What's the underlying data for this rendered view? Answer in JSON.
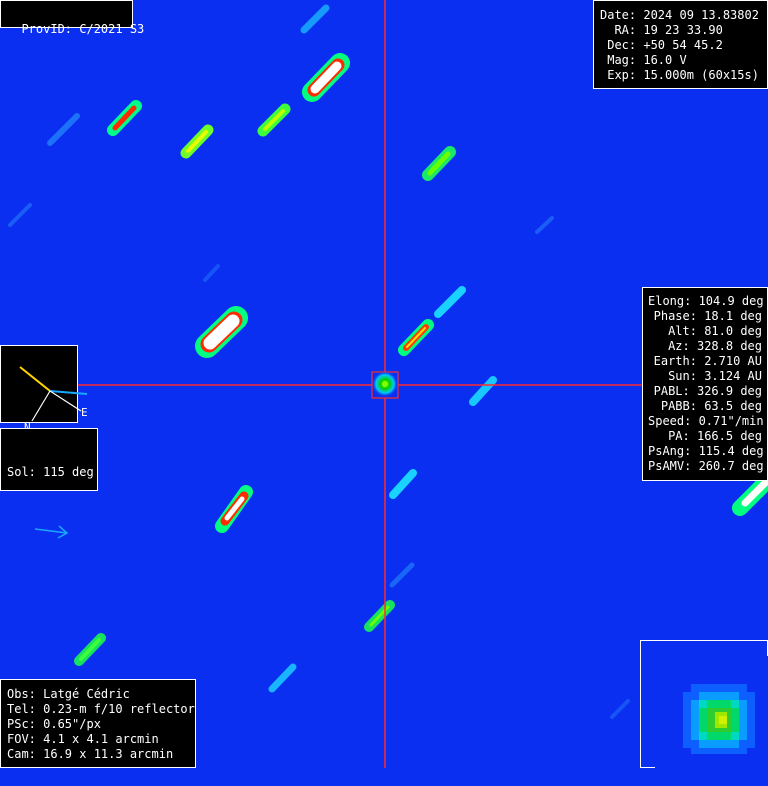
{
  "header": {
    "provid_label": "ProvID: C/2021 S3"
  },
  "observation": {
    "date": "Date: 2024 09 13.83802",
    "ra": "  RA: 19 23 33.90",
    "dec": " Dec: +50 54 45.2",
    "mag": " Mag: 16.0 V",
    "exp": " Exp: 15.000m (60x15s)"
  },
  "geometry": {
    "rows": [
      "Elong: 104.9 deg",
      "Phase: 18.1 deg",
      "Alt: 81.0 deg",
      "Az: 328.8 deg",
      "Earth: 2.710 AU",
      "Sun: 3.124 AU",
      "PABL: 326.9 deg",
      "PABB: 63.5 deg",
      "Speed: 0.71\"/min",
      "PA: 166.5 deg",
      "PsAng: 115.4 deg",
      "PsAMV: 260.7 deg"
    ]
  },
  "orientation": {
    "north_label": "N",
    "east_label": "E"
  },
  "sol": {
    "label": "Sol: 115 deg"
  },
  "equipment": {
    "obs": "Obs: Latgé Cédric",
    "tel": "Tel: 0.23-m f/10 reflector",
    "psc": "PSc: 0.65\"/px",
    "fov": "FOV: 4.1 x 4.1 arcmin",
    "cam": "Cam: 16.9 x 11.3 arcmin"
  },
  "colors": {
    "background": "#0a2ff0",
    "crosshair": "#ff2a2a"
  }
}
